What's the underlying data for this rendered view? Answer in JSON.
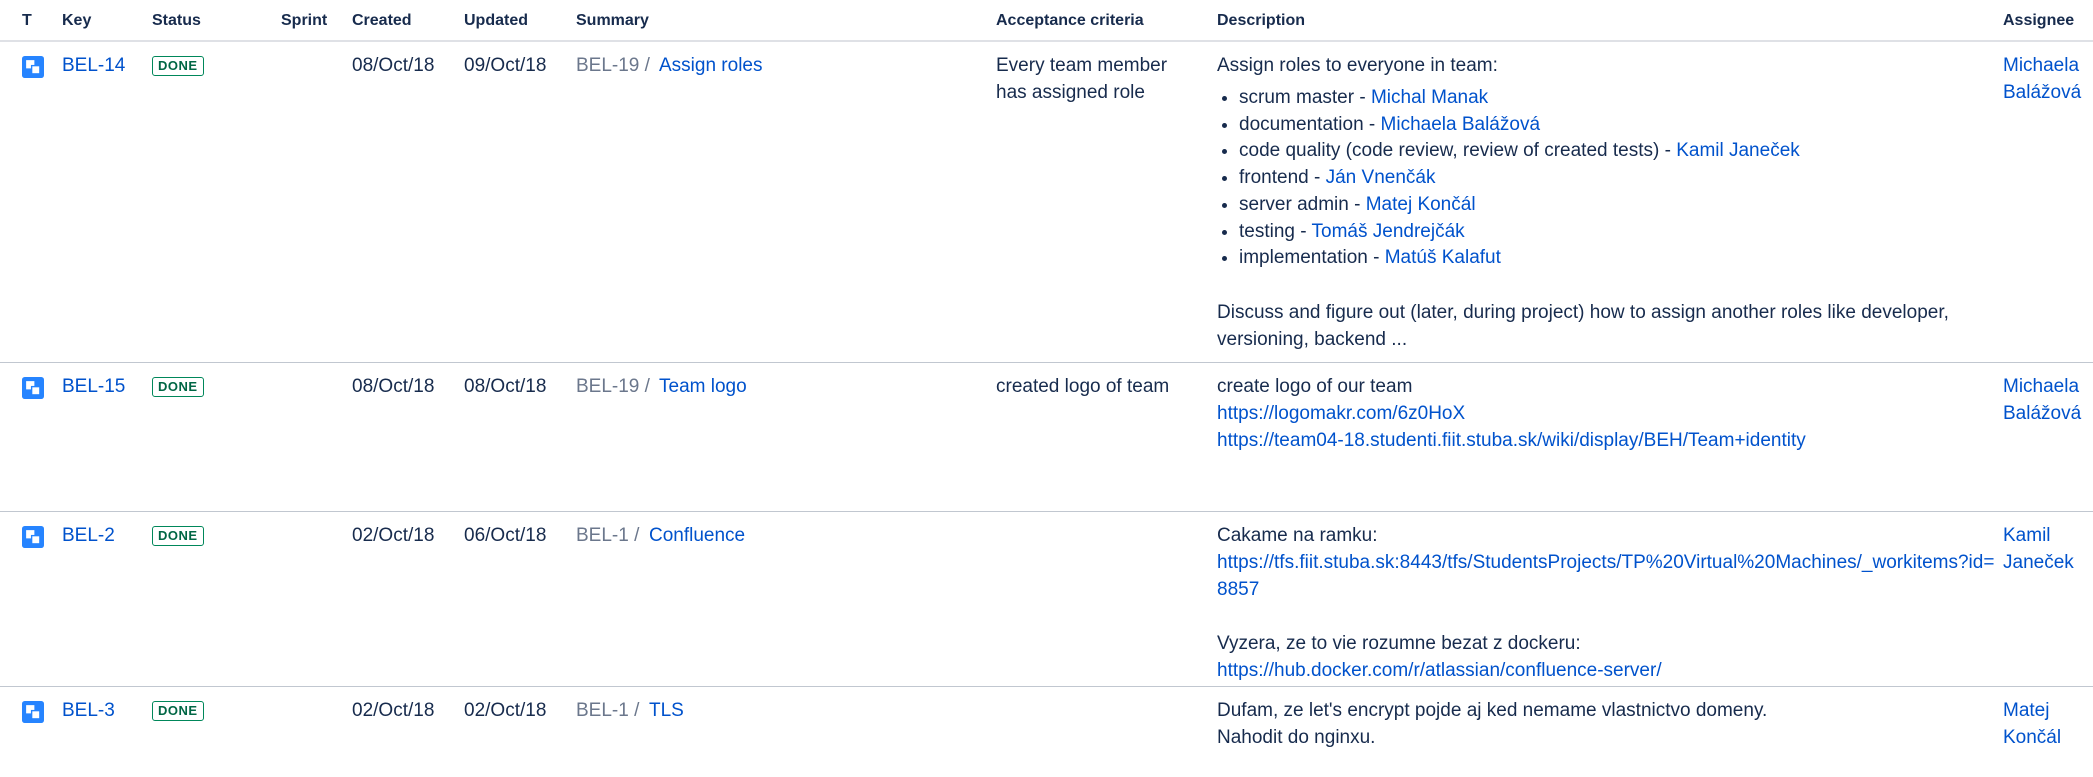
{
  "columns": {
    "type": "T",
    "key": "Key",
    "status": "Status",
    "sprint": "Sprint",
    "created": "Created",
    "updated": "Updated",
    "summary": "Summary",
    "acceptance": "Acceptance criteria",
    "description": "Description",
    "assignee": "Assignee"
  },
  "colors": {
    "link": "#0052cc",
    "done": "#00875a",
    "icon": "#2684ff"
  },
  "rows": [
    {
      "type_icon": "subtask-icon",
      "key": "BEL-14",
      "status": "DONE",
      "created": "08/Oct/18",
      "updated": "09/Oct/18",
      "parent": "BEL-19 /",
      "summary": "Assign roles",
      "acceptance": "Every team member has assigned role",
      "description": {
        "intro": "Assign roles to everyone in team:",
        "roles": [
          {
            "role": "scrum master - ",
            "person": "Michal Manak"
          },
          {
            "role": "documentation - ",
            "person": "Michaela Balážová"
          },
          {
            "role": "code quality (code review, review of created tests) - ",
            "person": "Kamil Janeček"
          },
          {
            "role": "frontend - ",
            "person": "Ján Vnenčák"
          },
          {
            "role": "server admin - ",
            "person": "Matej Končál"
          },
          {
            "role": "testing - ",
            "person": "Tomáš Jendrejčák"
          },
          {
            "role": "implementation - ",
            "person": "Matúš Kalafut"
          }
        ],
        "outro": "Discuss and figure out (later, during project) how to assign another roles like developer, versioning, backend ..."
      },
      "assignee": "Michaela Balážová"
    },
    {
      "type_icon": "subtask-icon",
      "key": "BEL-15",
      "status": "DONE",
      "created": "08/Oct/18",
      "updated": "08/Oct/18",
      "parent": "BEL-19 /",
      "summary": "Team logo",
      "acceptance": "created logo of team",
      "description": {
        "text1": "create logo of our team",
        "link1": "https://logomakr.com/6z0HoX",
        "link2": "https://team04-18.studenti.fiit.stuba.sk/wiki/display/BEH/Team+identity"
      },
      "assignee": "Michaela Balážová"
    },
    {
      "type_icon": "subtask-icon",
      "key": "BEL-2",
      "status": "DONE",
      "created": "02/Oct/18",
      "updated": "06/Oct/18",
      "parent": "BEL-1 /",
      "summary": "Confluence",
      "acceptance": "",
      "description": {
        "text1": "Cakame na ramku:",
        "link1": "https://tfs.fiit.stuba.sk:8443/tfs/StudentsProjects/TP%20Virtual%20Machines/_workitems?id=8857",
        "text2": "Vyzera, ze to vie rozumne bezat z dockeru:",
        "link2": "https://hub.docker.com/r/atlassian/confluence-server/"
      },
      "assignee": "Kamil Janeček"
    },
    {
      "type_icon": "subtask-icon",
      "key": "BEL-3",
      "status": "DONE",
      "created": "02/Oct/18",
      "updated": "02/Oct/18",
      "parent": "BEL-1 /",
      "summary": "TLS",
      "acceptance": "",
      "description": {
        "text1": "Dufam, ze let's encrypt pojde aj ked nemame vlastnictvo domeny.",
        "text2": "Nahodit do nginxu."
      },
      "assignee": "Matej Končál"
    }
  ]
}
